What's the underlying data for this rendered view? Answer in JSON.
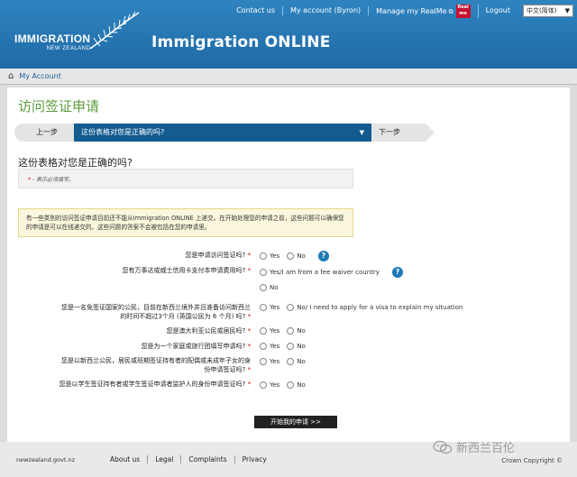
{
  "header": {
    "toplinks": {
      "contact": "Contact us",
      "account": "My account (Byron)",
      "realme": "Manage my RealMe",
      "realme_badge_top": "Real",
      "realme_badge_bottom": "me",
      "logout": "Logout"
    },
    "language": "中文(简体)",
    "logo_main": "IMMIGRATION",
    "logo_sub": "NEW ZEALAND",
    "app_title": "Immigration ONLINE"
  },
  "account_bar": {
    "link": "My Account"
  },
  "page": {
    "title": "访问签证申请",
    "step_prev": "上一步",
    "step_current": "这份表格对您是正确的吗?",
    "step_next": "下一步",
    "section_question": "这份表格对您是正确的吗?",
    "required_note": "表示必须填写。",
    "notice": "有一些类别的访问签证申请目前还不能从Immigration ONLINE 上递交。在开始处理您的申请之前，这些问题可以确保您的申请是可以在线递交的。这些问题的答案不会被包括在您的申请里。",
    "start_button": "开始我的申请 >>"
  },
  "questions": [
    {
      "label": "您是申请访问签证吗?",
      "options": [
        "Yes",
        "No"
      ]
    },
    {
      "label": "您有万事达或威士信用卡支付本申请费用吗?",
      "options": [
        "Yes/I am from a fee waiver country",
        "No"
      ]
    },
    {
      "label": "您是一名免签证国家的公民，目前在新西兰境外并且准备访问新西兰的时间不超过3个月 (英国公民为 6 个月) 吗?",
      "options": [
        "Yes",
        "No/ I need to apply for a visa to explain my situation"
      ]
    },
    {
      "label": "您是澳大利亚公民或居民吗?",
      "options": [
        "Yes",
        "No"
      ]
    },
    {
      "label": "您是为一个家庭或旅行团填写申请吗?",
      "options": [
        "Yes",
        "No"
      ]
    },
    {
      "label": "您是以新西兰公民，居民或班期签证持有者的配偶或未成年子女的身份申请签证吗?",
      "options": [
        "Yes",
        "No"
      ]
    },
    {
      "label": "您是以学生签证持有者或学生签证申请者监护人的身份申请签证吗?",
      "options": [
        "Yes",
        "No"
      ]
    }
  ],
  "footer": {
    "brand": "newzealand.govt.nz",
    "links": [
      "About us",
      "Legal",
      "Complaints",
      "Privacy"
    ],
    "copyright": "Crown Copyright ©",
    "watermark": "新西兰百伦"
  },
  "colors": {
    "header_blue": "#2f84bf",
    "title_green": "#5b9c3c",
    "step_blue": "#135b91",
    "help_blue": "#1d79b8",
    "required_red": "#cc0000"
  }
}
